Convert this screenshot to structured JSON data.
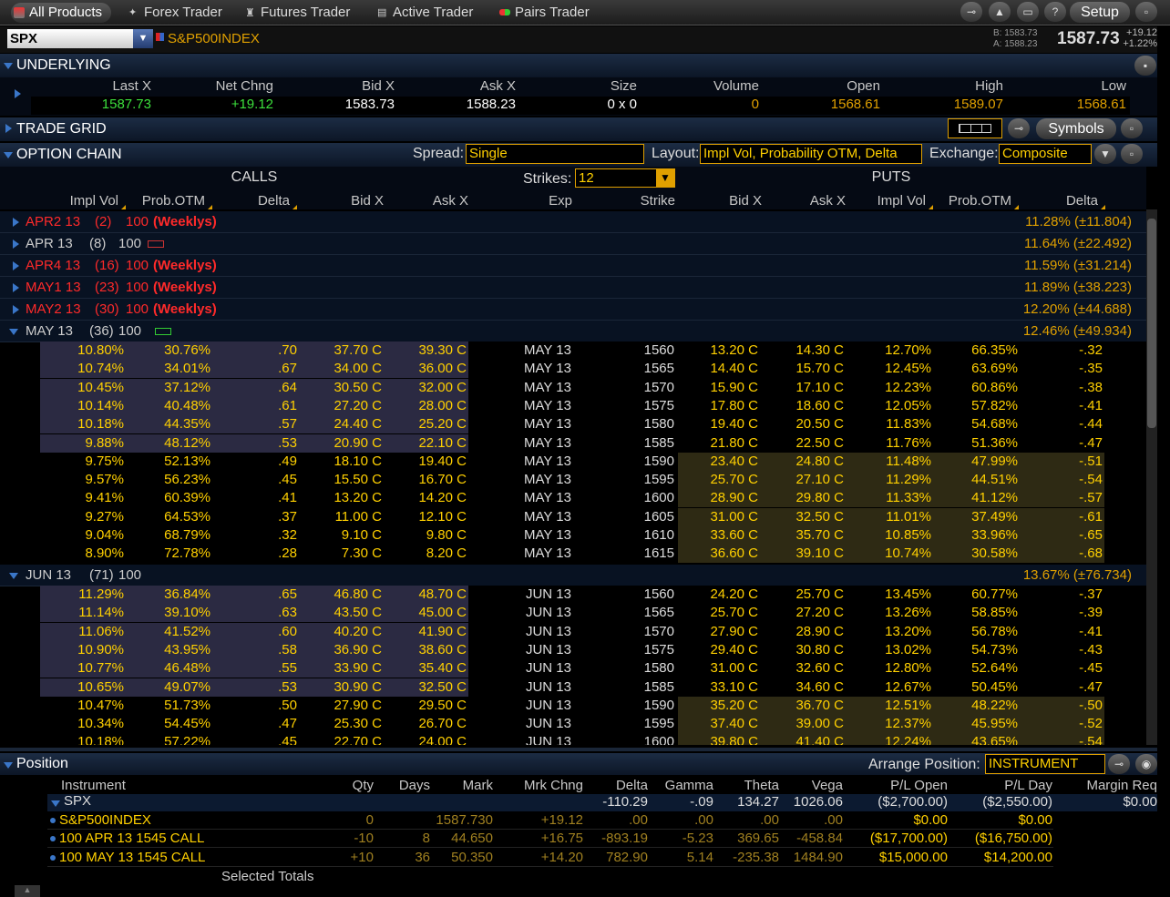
{
  "toolbar": {
    "tabs": [
      "All Products",
      "Forex Trader",
      "Futures Trader",
      "Active Trader",
      "Pairs Trader"
    ],
    "setup": "Setup"
  },
  "symbol": {
    "ticker": "SPX",
    "name": "S&P500INDEX",
    "bid": "B: 1583.73",
    "ask": "A: 1588.23",
    "last": "1587.73",
    "chg": "+19.12",
    "chg_pct": "+1.22%"
  },
  "underlying": {
    "title": "UNDERLYING",
    "headers": [
      "Last X",
      "Net Chng",
      "Bid X",
      "Ask X",
      "Size",
      "Volume",
      "Open",
      "High",
      "Low"
    ],
    "values": [
      "1587.73",
      "+19.12",
      "1583.73",
      "1588.23",
      "0 x 0",
      "0",
      "1568.61",
      "1589.07",
      "1568.61"
    ]
  },
  "trade_grid": {
    "title": "TRADE GRID",
    "symbols_button": "Symbols"
  },
  "option_chain": {
    "title": "OPTION CHAIN",
    "spread_label": "Spread:",
    "spread_value": "Single",
    "layout_label": "Layout:",
    "layout_value": "Impl Vol, Probability OTM, Delta",
    "exchange_label": "Exchange:",
    "exchange_value": "Composite",
    "calls_label": "CALLS",
    "puts_label": "PUTS",
    "strikes_label": "Strikes:",
    "strikes_value": "12",
    "col_headers": [
      "Impl Vol",
      "Prob.OTM",
      "Delta",
      "Bid X",
      "Ask X",
      "Exp",
      "Strike",
      "Bid X",
      "Ask X",
      "Impl Vol",
      "Prob.OTM",
      "Delta"
    ],
    "expirations": [
      {
        "label": "APR2 13",
        "days": "(2)",
        "mult": "100",
        "weekly": "(Weeklys)",
        "iv": "11.28% (±11.804)",
        "red": true
      },
      {
        "label": "APR 13",
        "days": "(8)",
        "mult": "100",
        "weekly": "",
        "iv": "11.64% (±22.492)",
        "red": false
      },
      {
        "label": "APR4 13",
        "days": "(16)",
        "mult": "100",
        "weekly": "(Weeklys)",
        "iv": "11.59% (±31.214)",
        "red": true
      },
      {
        "label": "MAY1 13",
        "days": "(23)",
        "mult": "100",
        "weekly": "(Weeklys)",
        "iv": "11.89% (±38.223)",
        "red": true
      },
      {
        "label": "MAY2 13",
        "days": "(30)",
        "mult": "100",
        "weekly": "(Weeklys)",
        "iv": "12.20% (±44.688)",
        "red": true
      },
      {
        "label": "MAY 13",
        "days": "(36)",
        "mult": "100",
        "weekly": "",
        "iv": "12.46% (±49.934)",
        "red": false
      }
    ],
    "may_rows": [
      [
        "10.80%",
        "30.76%",
        ".70",
        "37.70 C",
        "39.30 C",
        "MAY 13",
        "1560",
        "13.20 C",
        "14.30 C",
        "12.70%",
        "66.35%",
        "-.32"
      ],
      [
        "10.74%",
        "34.01%",
        ".67",
        "34.00 C",
        "36.00 C",
        "MAY 13",
        "1565",
        "14.40 C",
        "15.70 C",
        "12.45%",
        "63.69%",
        "-.35"
      ],
      [
        "10.45%",
        "37.12%",
        ".64",
        "30.50 C",
        "32.00 C",
        "MAY 13",
        "1570",
        "15.90 C",
        "17.10 C",
        "12.23%",
        "60.86%",
        "-.38"
      ],
      [
        "10.14%",
        "40.48%",
        ".61",
        "27.20 C",
        "28.00 C",
        "MAY 13",
        "1575",
        "17.80 C",
        "18.60 C",
        "12.05%",
        "57.82%",
        "-.41"
      ],
      [
        "10.18%",
        "44.35%",
        ".57",
        "24.40 C",
        "25.20 C",
        "MAY 13",
        "1580",
        "19.40 C",
        "20.50 C",
        "11.83%",
        "54.68%",
        "-.44"
      ],
      [
        "9.88%",
        "48.12%",
        ".53",
        "20.90 C",
        "22.10 C",
        "MAY 13",
        "1585",
        "21.80 C",
        "22.50 C",
        "11.76%",
        "51.36%",
        "-.47"
      ],
      [
        "9.75%",
        "52.13%",
        ".49",
        "18.10 C",
        "19.40 C",
        "MAY 13",
        "1590",
        "23.40 C",
        "24.80 C",
        "11.48%",
        "47.99%",
        "-.51"
      ],
      [
        "9.57%",
        "56.23%",
        ".45",
        "15.50 C",
        "16.70 C",
        "MAY 13",
        "1595",
        "25.70 C",
        "27.10 C",
        "11.29%",
        "44.51%",
        "-.54"
      ],
      [
        "9.41%",
        "60.39%",
        ".41",
        "13.20 C",
        "14.20 C",
        "MAY 13",
        "1600",
        "28.90 C",
        "29.80 C",
        "11.33%",
        "41.12%",
        "-.57"
      ],
      [
        "9.27%",
        "64.53%",
        ".37",
        "11.00 C",
        "12.10 C",
        "MAY 13",
        "1605",
        "31.00 C",
        "32.50 C",
        "11.01%",
        "37.49%",
        "-.61"
      ],
      [
        "9.04%",
        "68.79%",
        ".32",
        "9.10 C",
        "9.80 C",
        "MAY 13",
        "1610",
        "33.60 C",
        "35.70 C",
        "10.85%",
        "33.96%",
        "-.65"
      ],
      [
        "8.90%",
        "72.78%",
        ".28",
        "7.30 C",
        "8.20 C",
        "MAY 13",
        "1615",
        "36.60 C",
        "39.10 C",
        "10.74%",
        "30.58%",
        "-.68"
      ]
    ],
    "jun": {
      "label": "JUN 13",
      "days": "(71)",
      "mult": "100",
      "iv": "13.67% (±76.734)"
    },
    "jun_rows": [
      [
        "11.29%",
        "36.84%",
        ".65",
        "46.80 C",
        "48.70 C",
        "JUN 13",
        "1560",
        "24.20 C",
        "25.70 C",
        "13.45%",
        "60.77%",
        "-.37"
      ],
      [
        "11.14%",
        "39.10%",
        ".63",
        "43.50 C",
        "45.00 C",
        "JUN 13",
        "1565",
        "25.70 C",
        "27.20 C",
        "13.26%",
        "58.85%",
        "-.39"
      ],
      [
        "11.06%",
        "41.52%",
        ".60",
        "40.20 C",
        "41.90 C",
        "JUN 13",
        "1570",
        "27.90 C",
        "28.90 C",
        "13.20%",
        "56.78%",
        "-.41"
      ],
      [
        "10.90%",
        "43.95%",
        ".58",
        "36.90 C",
        "38.60 C",
        "JUN 13",
        "1575",
        "29.40 C",
        "30.80 C",
        "13.02%",
        "54.73%",
        "-.43"
      ],
      [
        "10.77%",
        "46.48%",
        ".55",
        "33.90 C",
        "35.40 C",
        "JUN 13",
        "1580",
        "31.00 C",
        "32.60 C",
        "12.80%",
        "52.64%",
        "-.45"
      ],
      [
        "10.65%",
        "49.07%",
        ".53",
        "30.90 C",
        "32.50 C",
        "JUN 13",
        "1585",
        "33.10 C",
        "34.60 C",
        "12.67%",
        "50.45%",
        "-.47"
      ],
      [
        "10.47%",
        "51.73%",
        ".50",
        "27.90 C",
        "29.50 C",
        "JUN 13",
        "1590",
        "35.20 C",
        "36.70 C",
        "12.51%",
        "48.22%",
        "-.50"
      ],
      [
        "10.34%",
        "54.45%",
        ".47",
        "25.30 C",
        "26.70 C",
        "JUN 13",
        "1595",
        "37.40 C",
        "39.00 C",
        "12.37%",
        "45.95%",
        "-.52"
      ],
      [
        "10.18%",
        "57.22%",
        ".45",
        "22.70 C",
        "24.00 C",
        "JUN 13",
        "1600",
        "39.80 C",
        "41.40 C",
        "12.24%",
        "43.65%",
        "-.54"
      ]
    ]
  },
  "position": {
    "title": "Position",
    "arrange_label": "Arrange Position:",
    "arrange_value": "INSTRUMENT",
    "headers": [
      "Instrument",
      "Qty",
      "Days",
      "Mark",
      "Mrk Chng",
      "Delta",
      "Gamma",
      "Theta",
      "Vega",
      "P/L Open",
      "P/L Day",
      "Margin Req"
    ],
    "group": {
      "name": "SPX",
      "delta": "-110.29",
      "gamma": "-.09",
      "theta": "134.27",
      "vega": "1026.06",
      "pl_open": "($2,700.00)",
      "pl_day": "($2,550.00)",
      "margin": "$0.00"
    },
    "rows": [
      [
        "S&P500INDEX",
        "0",
        "",
        "1587.730",
        "+19.12",
        ".00",
        ".00",
        ".00",
        ".00",
        "$0.00",
        "$0.00"
      ],
      [
        "100 APR 13 1545 CALL",
        "-10",
        "8",
        "44.650",
        "+16.75",
        "-893.19",
        "-5.23",
        "369.65",
        "-458.84",
        "($17,700.00)",
        "($16,750.00)"
      ],
      [
        "100 MAY 13 1545 CALL",
        "+10",
        "36",
        "50.350",
        "+14.20",
        "782.90",
        "5.14",
        "-235.38",
        "1484.90",
        "$15,000.00",
        "$14,200.00"
      ]
    ],
    "totals_label": "Selected Totals"
  },
  "colors": {
    "accent": "#e0a000",
    "calls_itm_bg": "#2b2a42",
    "puts_itm_bg": "#2e2a14",
    "pos_green": "#3ce03c",
    "neg_red": "#ff2020"
  }
}
